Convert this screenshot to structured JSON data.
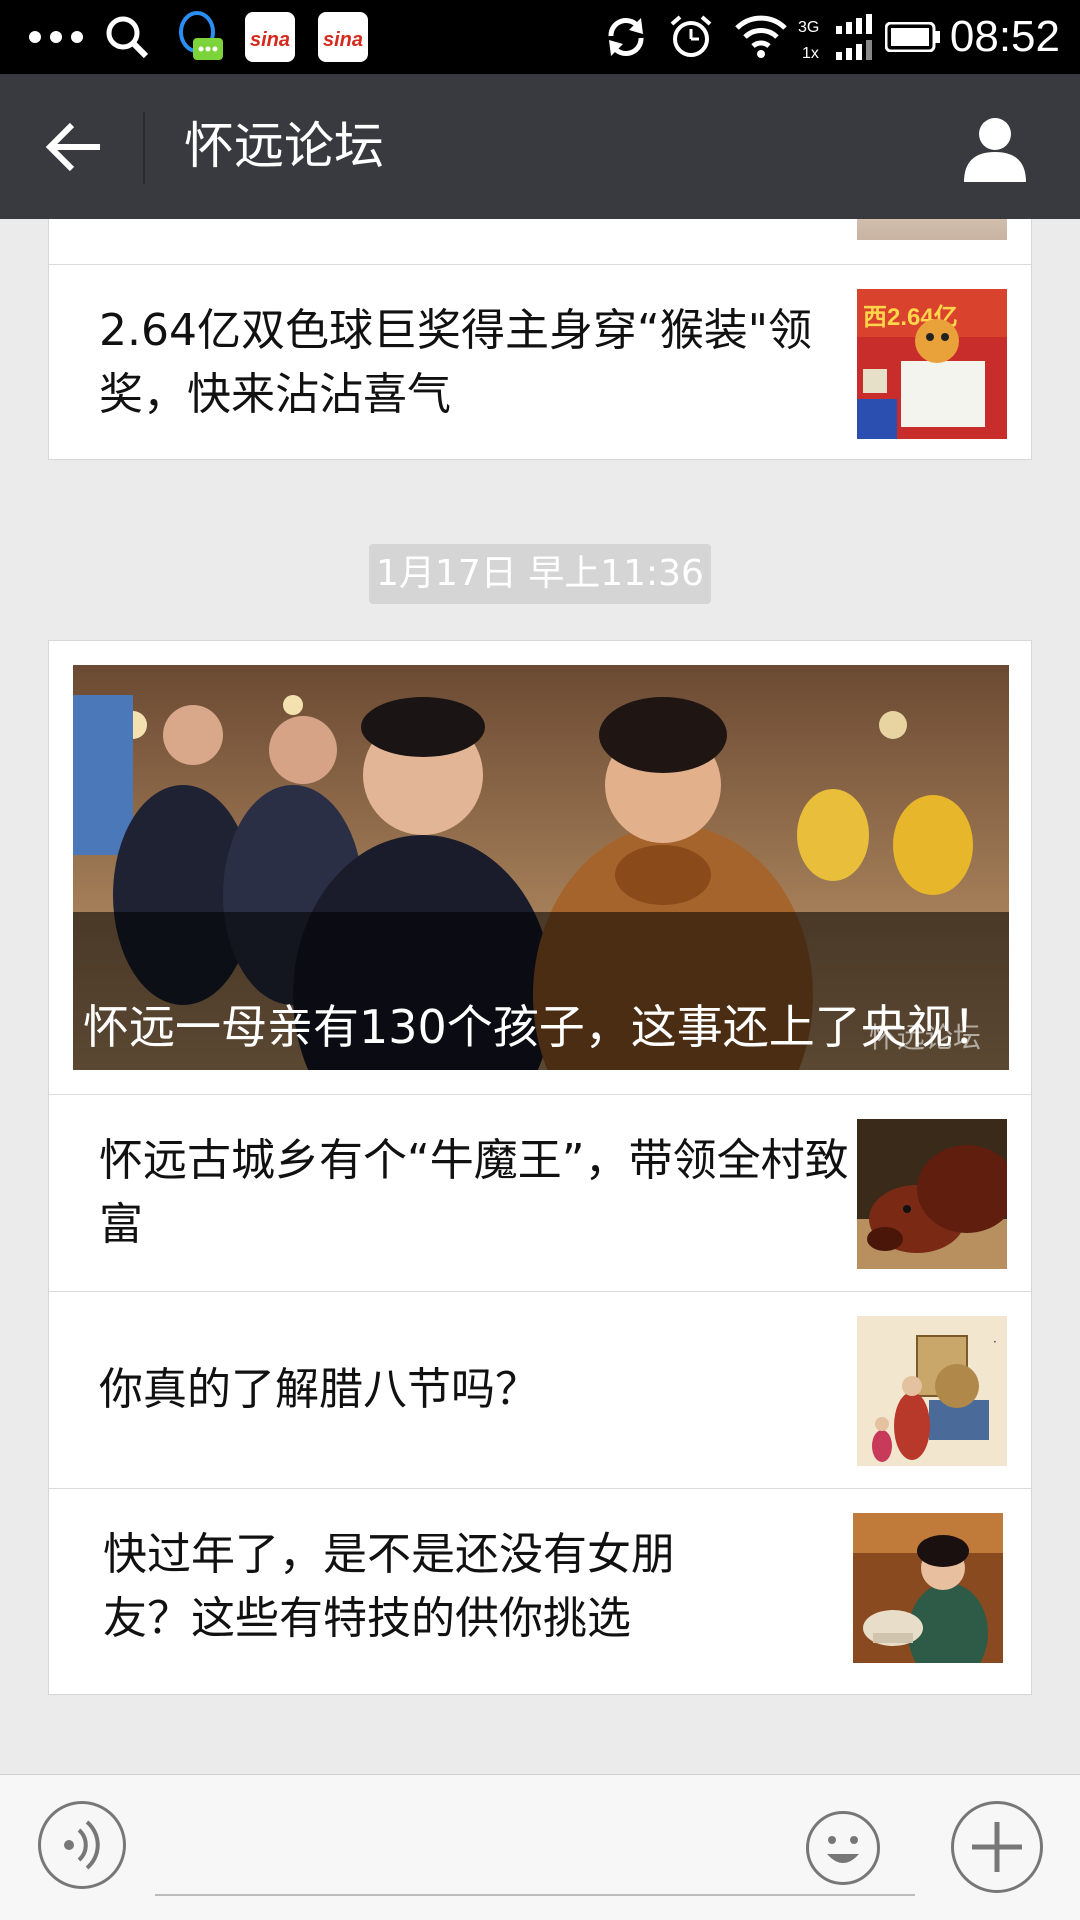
{
  "status_bar": {
    "time": "08:52",
    "icons": [
      "more-icon",
      "search-icon",
      "qq-icon",
      "sina-icon",
      "sina-icon",
      "sync-icon",
      "alarm-icon",
      "wifi-icon",
      "signal-icon",
      "battery-icon"
    ]
  },
  "header": {
    "title": "怀远论坛",
    "back_icon": "back-arrow-icon",
    "profile_icon": "profile-icon"
  },
  "feed": {
    "top_card": {
      "items": [
        {
          "title": "2.64亿双色球巨奖得主身穿“猴装\"领奖，快来沾沾喜气"
        }
      ]
    },
    "timestamp": "1月17日 早上11:36",
    "main_card": {
      "hero": {
        "title": "怀远一母亲有130个孩子，这事还上了央视！",
        "watermark": "怀远论坛"
      },
      "items": [
        {
          "title": "怀远古城乡有个“牛魔王”，带领全村致富"
        },
        {
          "title": "你真的了解腊八节吗？"
        },
        {
          "title": "快过年了，是不是还没有女朋友？这些有特技的供你挑选"
        }
      ]
    }
  },
  "bottom_bar": {
    "voice_icon": "voice-icon",
    "emoji_icon": "emoji-icon",
    "plus_icon": "plus-icon"
  },
  "colors": {
    "status_bar": "#000000",
    "title_bar": "#393a3f",
    "background": "#ebebeb",
    "card": "#ffffff"
  }
}
